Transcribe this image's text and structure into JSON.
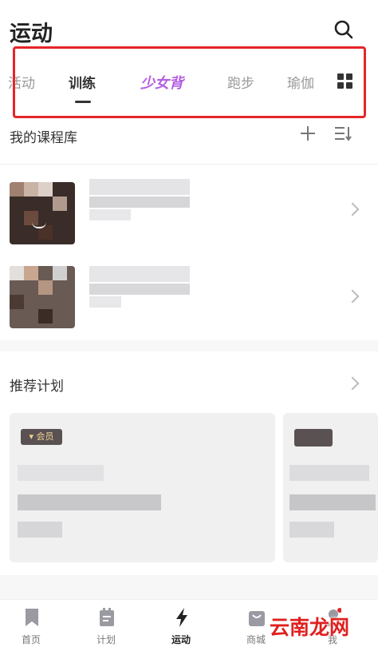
{
  "header": {
    "title": "运动",
    "tabs": [
      {
        "label": "活动",
        "state": "partial"
      },
      {
        "label": "训练",
        "state": "active"
      },
      {
        "label": "少女背",
        "state": "special"
      },
      {
        "label": "跑步",
        "state": "normal"
      },
      {
        "label": "瑜伽",
        "state": "normal"
      }
    ]
  },
  "courses": {
    "section_title": "我的课程库"
  },
  "plans": {
    "section_title": "推荐计划",
    "badge_label": "会员"
  },
  "nav": {
    "items": [
      {
        "label": "首页",
        "icon": "bookmark-icon"
      },
      {
        "label": "计划",
        "icon": "calendar-icon"
      },
      {
        "label": "运动",
        "icon": "lightning-icon"
      },
      {
        "label": "商城",
        "icon": "shop-bag-icon"
      },
      {
        "label": "我",
        "icon": "profile-icon"
      }
    ]
  },
  "watermark": "云南龙网",
  "colors": {
    "highlight_border": "#e5252a",
    "special_tab": "#b45fe0",
    "badge_bg": "#5a5252",
    "badge_text": "#f2d29a",
    "watermark": "#e02020"
  }
}
